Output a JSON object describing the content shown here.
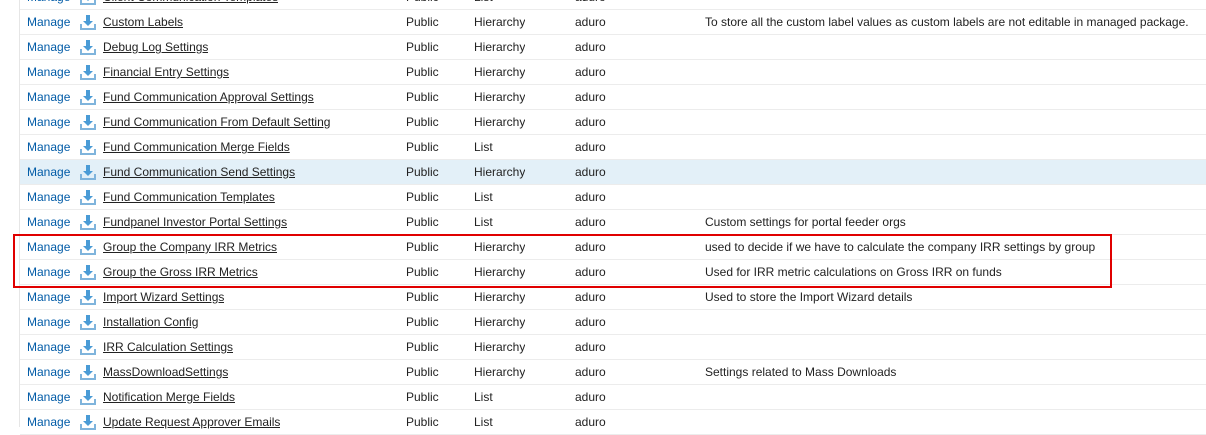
{
  "colors": {
    "link": "#015ba7",
    "hover_row": "#e3f0f8",
    "highlight_border": "#e00000",
    "icon": "#4a9bd6"
  },
  "rows": [
    {
      "action": "Manage",
      "label": "Client Communication Templates",
      "visibility": "Public",
      "type": "List",
      "namespace": "aduro",
      "description": ""
    },
    {
      "action": "Manage",
      "label": "Custom Labels",
      "visibility": "Public",
      "type": "Hierarchy",
      "namespace": "aduro",
      "description": "To store all the custom label values as custom labels are not editable in managed package."
    },
    {
      "action": "Manage",
      "label": "Debug Log Settings",
      "visibility": "Public",
      "type": "Hierarchy",
      "namespace": "aduro",
      "description": ""
    },
    {
      "action": "Manage",
      "label": "Financial Entry Settings",
      "visibility": "Public",
      "type": "Hierarchy",
      "namespace": "aduro",
      "description": ""
    },
    {
      "action": "Manage",
      "label": "Fund Communication Approval Settings",
      "visibility": "Public",
      "type": "Hierarchy",
      "namespace": "aduro",
      "description": ""
    },
    {
      "action": "Manage",
      "label": "Fund Communication From Default Setting",
      "visibility": "Public",
      "type": "Hierarchy",
      "namespace": "aduro",
      "description": ""
    },
    {
      "action": "Manage",
      "label": "Fund Communication Merge Fields",
      "visibility": "Public",
      "type": "List",
      "namespace": "aduro",
      "description": ""
    },
    {
      "action": "Manage",
      "label": "Fund Communication Send Settings",
      "visibility": "Public",
      "type": "Hierarchy",
      "namespace": "aduro",
      "description": "",
      "hover": true
    },
    {
      "action": "Manage",
      "label": "Fund Communication Templates",
      "visibility": "Public",
      "type": "List",
      "namespace": "aduro",
      "description": ""
    },
    {
      "action": "Manage",
      "label": "Fundpanel Investor Portal Settings",
      "visibility": "Public",
      "type": "List",
      "namespace": "aduro",
      "description": "Custom settings for portal feeder orgs"
    },
    {
      "action": "Manage",
      "label": "Group the Company IRR Metrics",
      "visibility": "Public",
      "type": "Hierarchy",
      "namespace": "aduro",
      "description": "used to decide if we have to calculate the company IRR settings by group"
    },
    {
      "action": "Manage",
      "label": "Group the Gross IRR Metrics",
      "visibility": "Public",
      "type": "Hierarchy",
      "namespace": "aduro",
      "description": "Used for IRR metric calculations on Gross IRR on funds"
    },
    {
      "action": "Manage",
      "label": "Import Wizard Settings",
      "visibility": "Public",
      "type": "Hierarchy",
      "namespace": "aduro",
      "description": "Used to store the Import Wizard details"
    },
    {
      "action": "Manage",
      "label": "Installation Config",
      "visibility": "Public",
      "type": "Hierarchy",
      "namespace": "aduro",
      "description": ""
    },
    {
      "action": "Manage",
      "label": "IRR Calculation Settings",
      "visibility": "Public",
      "type": "Hierarchy",
      "namespace": "aduro",
      "description": ""
    },
    {
      "action": "Manage",
      "label": "MassDownloadSettings",
      "visibility": "Public",
      "type": "Hierarchy",
      "namespace": "aduro",
      "description": "Settings related to Mass Downloads"
    },
    {
      "action": "Manage",
      "label": "Notification Merge Fields",
      "visibility": "Public",
      "type": "List",
      "namespace": "aduro",
      "description": ""
    },
    {
      "action": "Manage",
      "label": "Update Request Approver Emails",
      "visibility": "Public",
      "type": "List",
      "namespace": "aduro",
      "description": ""
    }
  ]
}
